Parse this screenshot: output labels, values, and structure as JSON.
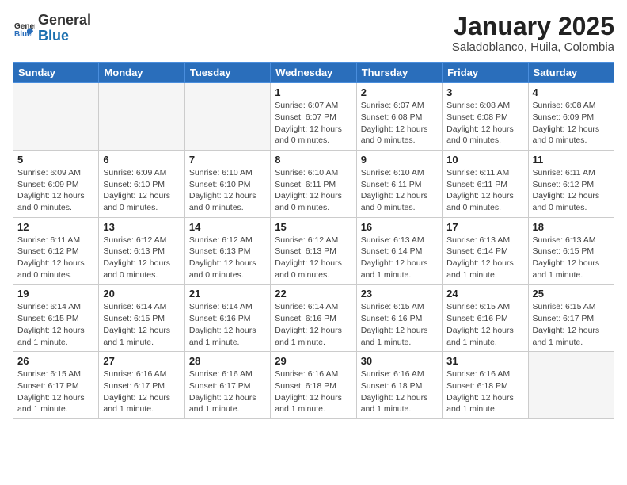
{
  "header": {
    "logo_general": "General",
    "logo_blue": "Blue",
    "month_title": "January 2025",
    "location": "Saladoblanco, Huila, Colombia"
  },
  "calendar": {
    "days_of_week": [
      "Sunday",
      "Monday",
      "Tuesday",
      "Wednesday",
      "Thursday",
      "Friday",
      "Saturday"
    ],
    "weeks": [
      [
        {
          "day": "",
          "info": ""
        },
        {
          "day": "",
          "info": ""
        },
        {
          "day": "",
          "info": ""
        },
        {
          "day": "1",
          "info": "Sunrise: 6:07 AM\nSunset: 6:07 PM\nDaylight: 12 hours\nand 0 minutes."
        },
        {
          "day": "2",
          "info": "Sunrise: 6:07 AM\nSunset: 6:08 PM\nDaylight: 12 hours\nand 0 minutes."
        },
        {
          "day": "3",
          "info": "Sunrise: 6:08 AM\nSunset: 6:08 PM\nDaylight: 12 hours\nand 0 minutes."
        },
        {
          "day": "4",
          "info": "Sunrise: 6:08 AM\nSunset: 6:09 PM\nDaylight: 12 hours\nand 0 minutes."
        }
      ],
      [
        {
          "day": "5",
          "info": "Sunrise: 6:09 AM\nSunset: 6:09 PM\nDaylight: 12 hours\nand 0 minutes."
        },
        {
          "day": "6",
          "info": "Sunrise: 6:09 AM\nSunset: 6:10 PM\nDaylight: 12 hours\nand 0 minutes."
        },
        {
          "day": "7",
          "info": "Sunrise: 6:10 AM\nSunset: 6:10 PM\nDaylight: 12 hours\nand 0 minutes."
        },
        {
          "day": "8",
          "info": "Sunrise: 6:10 AM\nSunset: 6:11 PM\nDaylight: 12 hours\nand 0 minutes."
        },
        {
          "day": "9",
          "info": "Sunrise: 6:10 AM\nSunset: 6:11 PM\nDaylight: 12 hours\nand 0 minutes."
        },
        {
          "day": "10",
          "info": "Sunrise: 6:11 AM\nSunset: 6:11 PM\nDaylight: 12 hours\nand 0 minutes."
        },
        {
          "day": "11",
          "info": "Sunrise: 6:11 AM\nSunset: 6:12 PM\nDaylight: 12 hours\nand 0 minutes."
        }
      ],
      [
        {
          "day": "12",
          "info": "Sunrise: 6:11 AM\nSunset: 6:12 PM\nDaylight: 12 hours\nand 0 minutes."
        },
        {
          "day": "13",
          "info": "Sunrise: 6:12 AM\nSunset: 6:13 PM\nDaylight: 12 hours\nand 0 minutes."
        },
        {
          "day": "14",
          "info": "Sunrise: 6:12 AM\nSunset: 6:13 PM\nDaylight: 12 hours\nand 0 minutes."
        },
        {
          "day": "15",
          "info": "Sunrise: 6:12 AM\nSunset: 6:13 PM\nDaylight: 12 hours\nand 0 minutes."
        },
        {
          "day": "16",
          "info": "Sunrise: 6:13 AM\nSunset: 6:14 PM\nDaylight: 12 hours\nand 1 minute."
        },
        {
          "day": "17",
          "info": "Sunrise: 6:13 AM\nSunset: 6:14 PM\nDaylight: 12 hours\nand 1 minute."
        },
        {
          "day": "18",
          "info": "Sunrise: 6:13 AM\nSunset: 6:15 PM\nDaylight: 12 hours\nand 1 minute."
        }
      ],
      [
        {
          "day": "19",
          "info": "Sunrise: 6:14 AM\nSunset: 6:15 PM\nDaylight: 12 hours\nand 1 minute."
        },
        {
          "day": "20",
          "info": "Sunrise: 6:14 AM\nSunset: 6:15 PM\nDaylight: 12 hours\nand 1 minute."
        },
        {
          "day": "21",
          "info": "Sunrise: 6:14 AM\nSunset: 6:16 PM\nDaylight: 12 hours\nand 1 minute."
        },
        {
          "day": "22",
          "info": "Sunrise: 6:14 AM\nSunset: 6:16 PM\nDaylight: 12 hours\nand 1 minute."
        },
        {
          "day": "23",
          "info": "Sunrise: 6:15 AM\nSunset: 6:16 PM\nDaylight: 12 hours\nand 1 minute."
        },
        {
          "day": "24",
          "info": "Sunrise: 6:15 AM\nSunset: 6:16 PM\nDaylight: 12 hours\nand 1 minute."
        },
        {
          "day": "25",
          "info": "Sunrise: 6:15 AM\nSunset: 6:17 PM\nDaylight: 12 hours\nand 1 minute."
        }
      ],
      [
        {
          "day": "26",
          "info": "Sunrise: 6:15 AM\nSunset: 6:17 PM\nDaylight: 12 hours\nand 1 minute."
        },
        {
          "day": "27",
          "info": "Sunrise: 6:16 AM\nSunset: 6:17 PM\nDaylight: 12 hours\nand 1 minute."
        },
        {
          "day": "28",
          "info": "Sunrise: 6:16 AM\nSunset: 6:17 PM\nDaylight: 12 hours\nand 1 minute."
        },
        {
          "day": "29",
          "info": "Sunrise: 6:16 AM\nSunset: 6:18 PM\nDaylight: 12 hours\nand 1 minute."
        },
        {
          "day": "30",
          "info": "Sunrise: 6:16 AM\nSunset: 6:18 PM\nDaylight: 12 hours\nand 1 minute."
        },
        {
          "day": "31",
          "info": "Sunrise: 6:16 AM\nSunset: 6:18 PM\nDaylight: 12 hours\nand 1 minute."
        },
        {
          "day": "",
          "info": ""
        }
      ]
    ]
  }
}
